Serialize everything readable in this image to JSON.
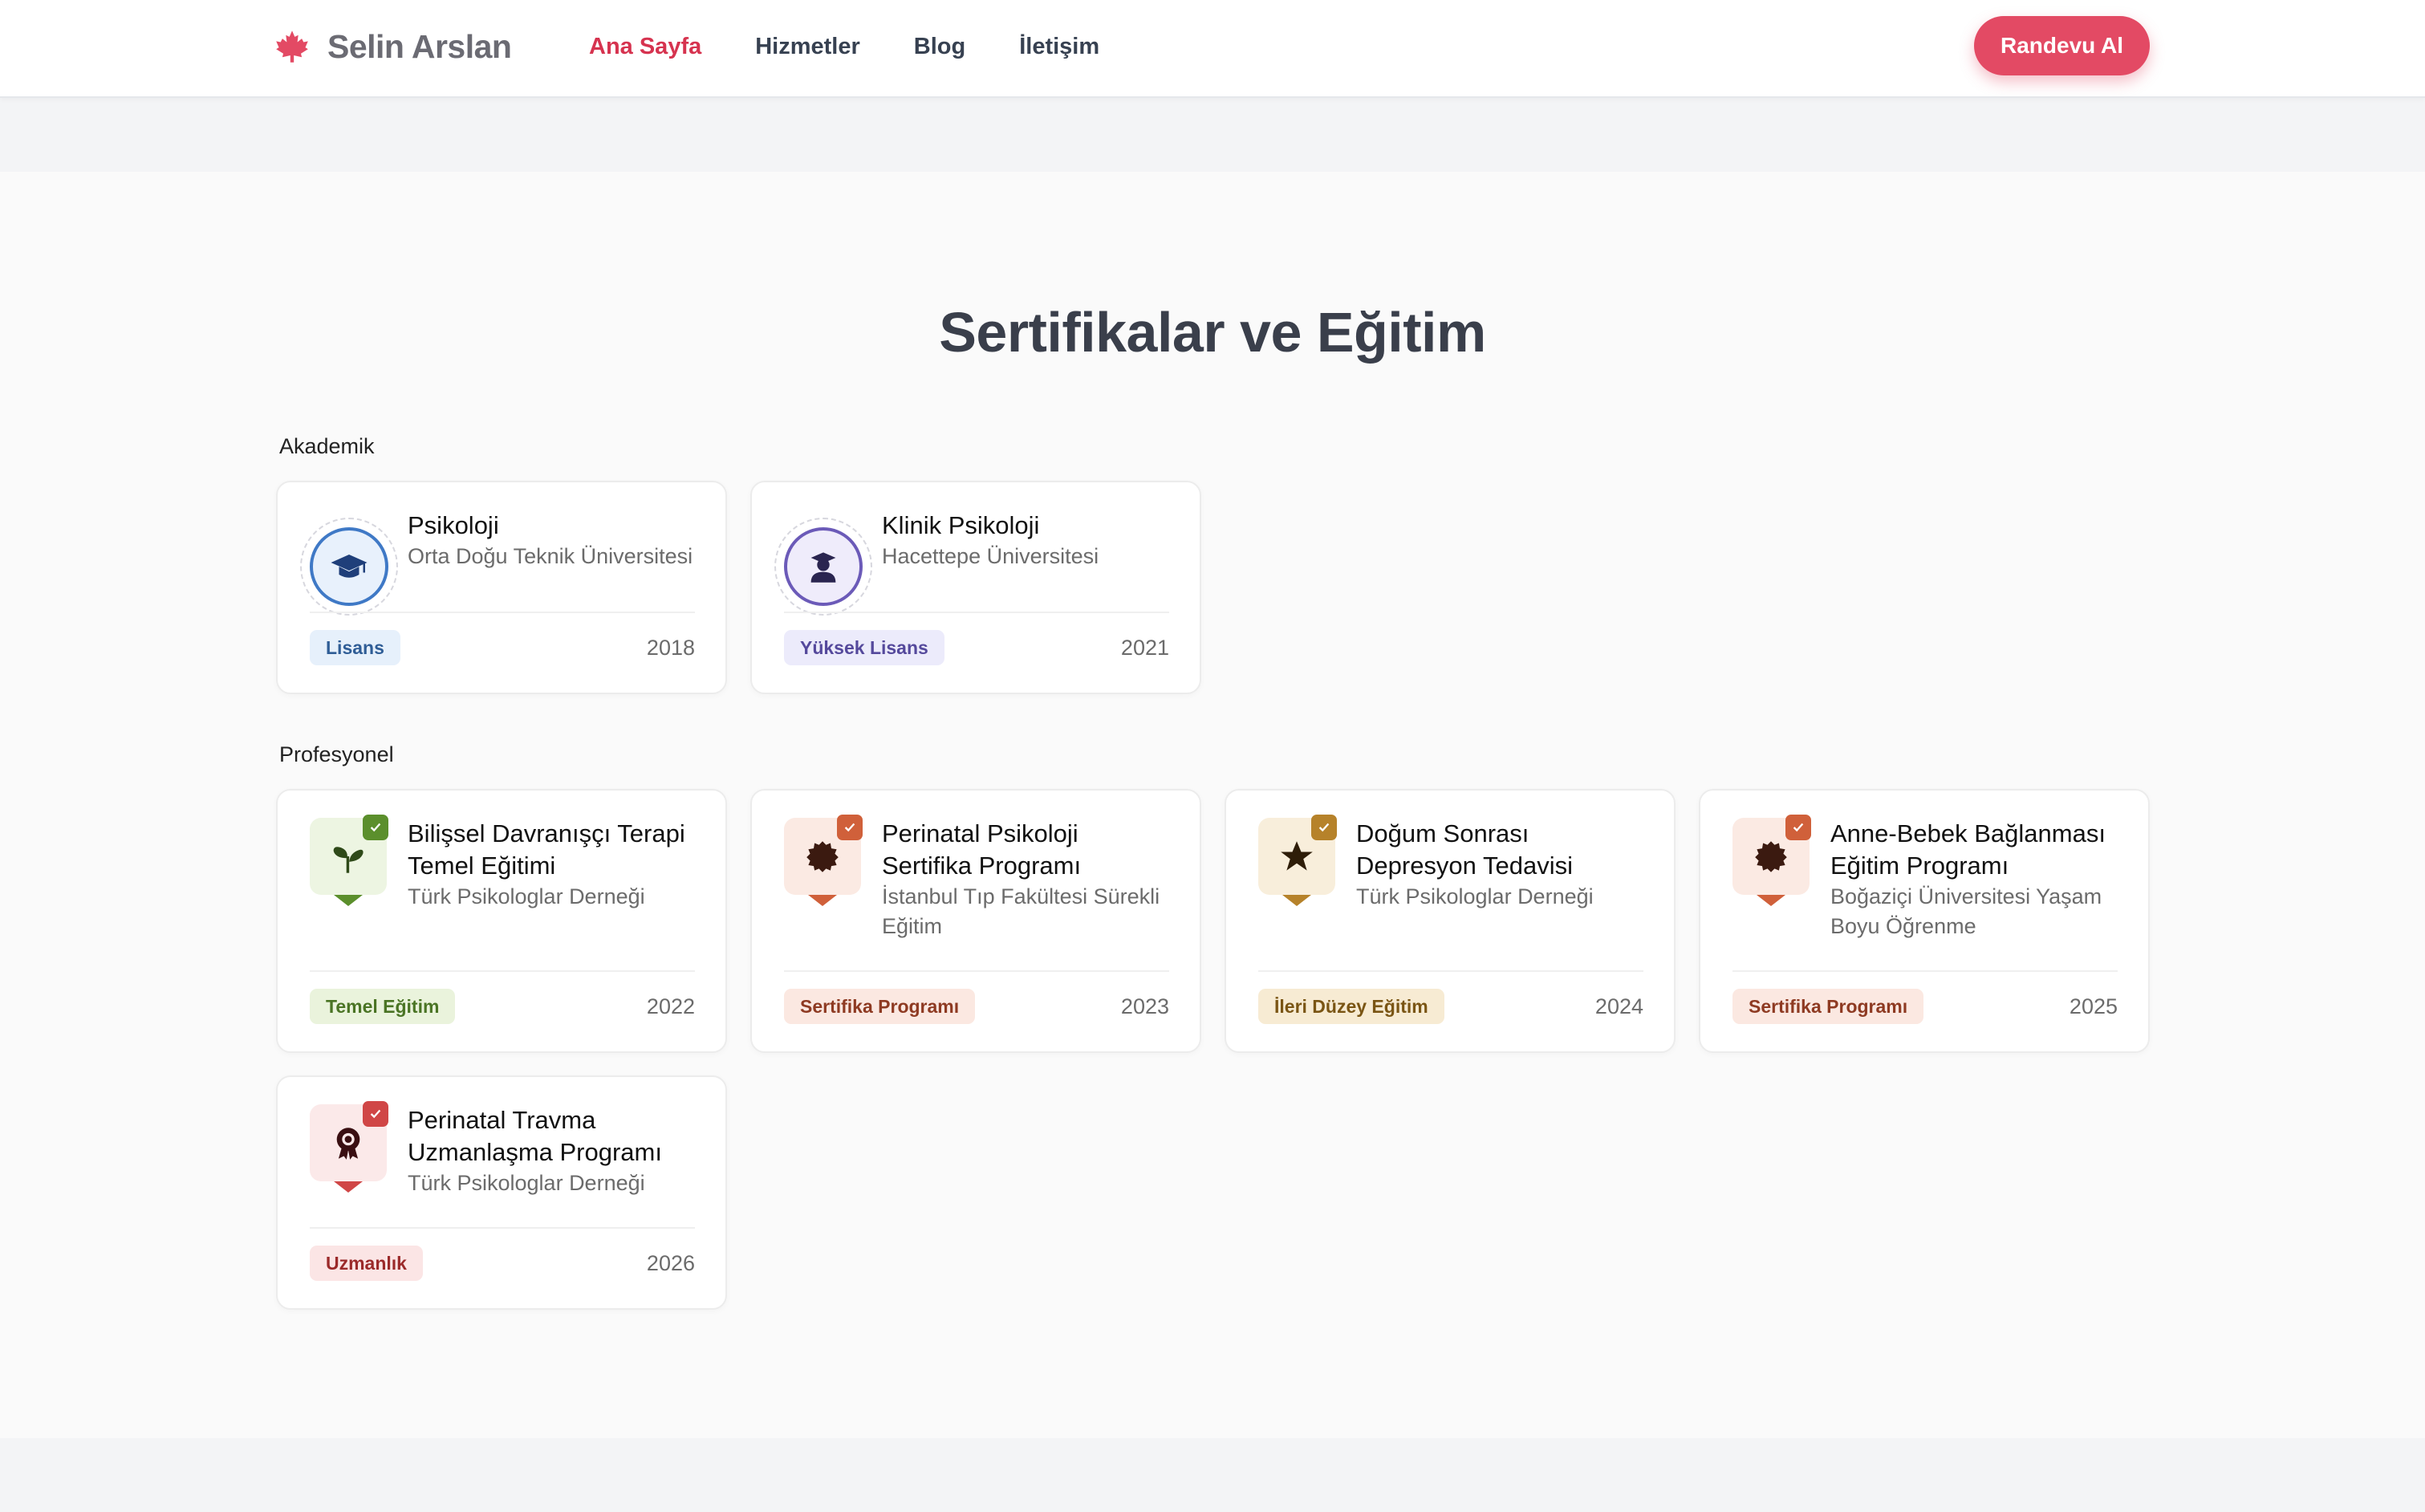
{
  "header": {
    "brand": "Selin Arslan",
    "nav": [
      {
        "label": "Ana Sayfa",
        "active": true
      },
      {
        "label": "Hizmetler",
        "active": false
      },
      {
        "label": "Blog",
        "active": false
      },
      {
        "label": "İletişim",
        "active": false
      }
    ],
    "cta": "Randevu Al"
  },
  "section": {
    "title": "Sertifikalar ve Eğitim",
    "groups": [
      {
        "label": "Akademik",
        "cards": [
          {
            "title": "Psikoloji",
            "subtitle": "Orta Doğu Teknik Üniversitesi",
            "badge": "Lisans",
            "year": "2018",
            "icon": "graduation-cap-icon"
          },
          {
            "title": "Klinik Psikoloji",
            "subtitle": "Hacettepe Üniversitesi",
            "badge": "Yüksek Lisans",
            "year": "2021",
            "icon": "graduate-person-icon"
          }
        ]
      },
      {
        "label": "Profesyonel",
        "cards": [
          {
            "title": "Bilişsel Davranışçı Terapi Temel Eğitimi",
            "subtitle": "Türk Psikologlar Derneği",
            "badge": "Temel Eğitim",
            "year": "2022",
            "icon": "seedling-icon"
          },
          {
            "title": "Perinatal Psikoloji Sertifika Programı",
            "subtitle": "İstanbul Tıp Fakültesi Sürekli Eğitim",
            "badge": "Sertifika Programı",
            "year": "2023",
            "icon": "certificate-seal-icon"
          },
          {
            "title": "Doğum Sonrası Depresyon Tedavisi",
            "subtitle": "Türk Psikologlar Derneği",
            "badge": "İleri Düzey Eğitim",
            "year": "2024",
            "icon": "star-icon"
          },
          {
            "title": "Anne-Bebek Bağlanması Eğitim Programı",
            "subtitle": "Boğaziçi Üniversitesi Yaşam Boyu Öğrenme",
            "badge": "Sertifika Programı",
            "year": "2025",
            "icon": "certificate-seal-icon"
          },
          {
            "title": "Perinatal Travma Uzmanlaşma Programı",
            "subtitle": "Türk Psikologlar Derneği",
            "badge": "Uzmanlık",
            "year": "2026",
            "icon": "award-ribbon-icon"
          }
        ]
      }
    ]
  },
  "colors": {
    "accent": "#e34a64",
    "nav_active": "#d6334f",
    "lisans_badge_bg": "#e6f0fb",
    "yuksek_lisans_badge_bg": "#ecebfb",
    "temel_green": "#5b8f2c",
    "sertifika_orange": "#d0603a",
    "ileri_gold": "#b6822a",
    "uzmanlik_red": "#d04646"
  }
}
